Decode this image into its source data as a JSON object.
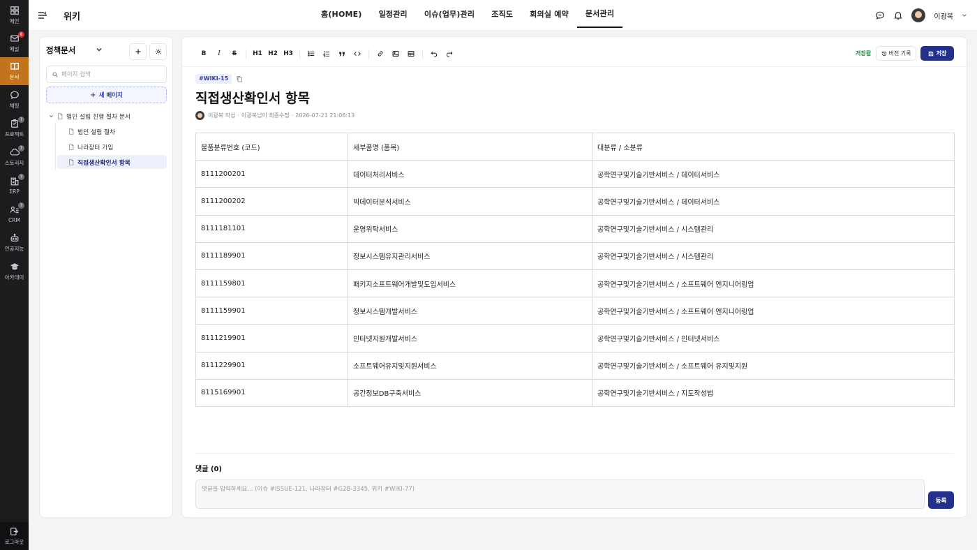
{
  "rail": {
    "items": [
      {
        "label": "메인",
        "icon": "grid-icon"
      },
      {
        "label": "메일",
        "icon": "mail-icon",
        "badge": "8"
      },
      {
        "label": "문서",
        "icon": "book-icon"
      },
      {
        "label": "채팅",
        "icon": "chat-icon"
      },
      {
        "label": "프로젝트",
        "icon": "clipboard-icon",
        "badge": "?"
      },
      {
        "label": "스토리지",
        "icon": "cloud-icon",
        "badge": "?"
      },
      {
        "label": "ERP",
        "icon": "building-icon",
        "badge": "?"
      },
      {
        "label": "CRM",
        "icon": "crm-icon",
        "badge": "?"
      },
      {
        "label": "인공지능",
        "icon": "robot-icon"
      },
      {
        "label": "아카데미",
        "icon": "graduation-cap-icon"
      }
    ],
    "logout_label": "로그아웃"
  },
  "topbar": {
    "page_name": "위키",
    "nav": [
      "홈(HOME)",
      "일정관리",
      "이슈(업무)관리",
      "조직도",
      "회의실 예약",
      "문서관리"
    ],
    "user_name": "이광복"
  },
  "sidebar": {
    "title": "정책문서",
    "search_placeholder": "페이지 검색",
    "new_page_label": "새 페이지",
    "tree": {
      "root": "법인 설립 진행 절차 문서",
      "children": [
        "법인 설립 절차",
        "나라장터 가입",
        "직접생산확인서 항목"
      ]
    }
  },
  "editor": {
    "toolbar": {
      "bold": "B",
      "italic": "I",
      "strike": "S",
      "h1": "H1",
      "h2": "H2",
      "h3": "H3"
    },
    "saved_label": "저장됨",
    "history_label": "버전 기록",
    "save_label": "저장",
    "doc_id": "#WIKI-15",
    "title": "직접생산확인서 항목",
    "meta": {
      "author": "이광복 작성",
      "modified": "이광복님이 최종수정",
      "timestamp": "2026-07-21 21:06:13"
    },
    "table": {
      "headers": [
        "물품분류번호 (코드)",
        "세부품명 (품목)",
        "대분류 / 소분류"
      ],
      "rows": [
        [
          "8111200201",
          "데이터처리서비스",
          "공학연구및기술기반서비스 / 데이터서비스"
        ],
        [
          "8111200202",
          "빅데이터분석서비스",
          "공학연구및기술기반서비스 / 데이터서비스"
        ],
        [
          "8111181101",
          "운영위탁서비스",
          "공학연구및기술기반서비스 / 시스템관리"
        ],
        [
          "8111189901",
          "정보시스템유지관리서비스",
          "공학연구및기술기반서비스 / 시스템관리"
        ],
        [
          "8111159801",
          "패키지소프트웨어개발및도입서비스",
          "공학연구및기술기반서비스 / 소프트웨어 엔지니어링업"
        ],
        [
          "8111159901",
          "정보시스템개발서비스",
          "공학연구및기술기반서비스 / 소프트웨어 엔지니어링업"
        ],
        [
          "8111219901",
          "인터넷지원개발서비스",
          "공학연구및기술기반서비스 / 인터넷서비스"
        ],
        [
          "8111229901",
          "소프트웨어유지및지원서비스",
          "공학연구및기술기반서비스 / 소프트웨어 유지및지원"
        ],
        [
          "8115169901",
          "공간정보DB구축서비스",
          "공학연구및기술기반서비스 / 지도작성법"
        ]
      ]
    },
    "comments": {
      "title": "댓글 (0)",
      "placeholder": "댓글을 입력하세요... (이슈 #ISSUE-121, 나라장터 #G2B-3345, 위키 #WIKI-77)",
      "submit_label": "등록"
    }
  },
  "colors": {
    "accent": "#23318a",
    "rail_active": "#c2731c",
    "saved_green": "#1e8a3d"
  }
}
